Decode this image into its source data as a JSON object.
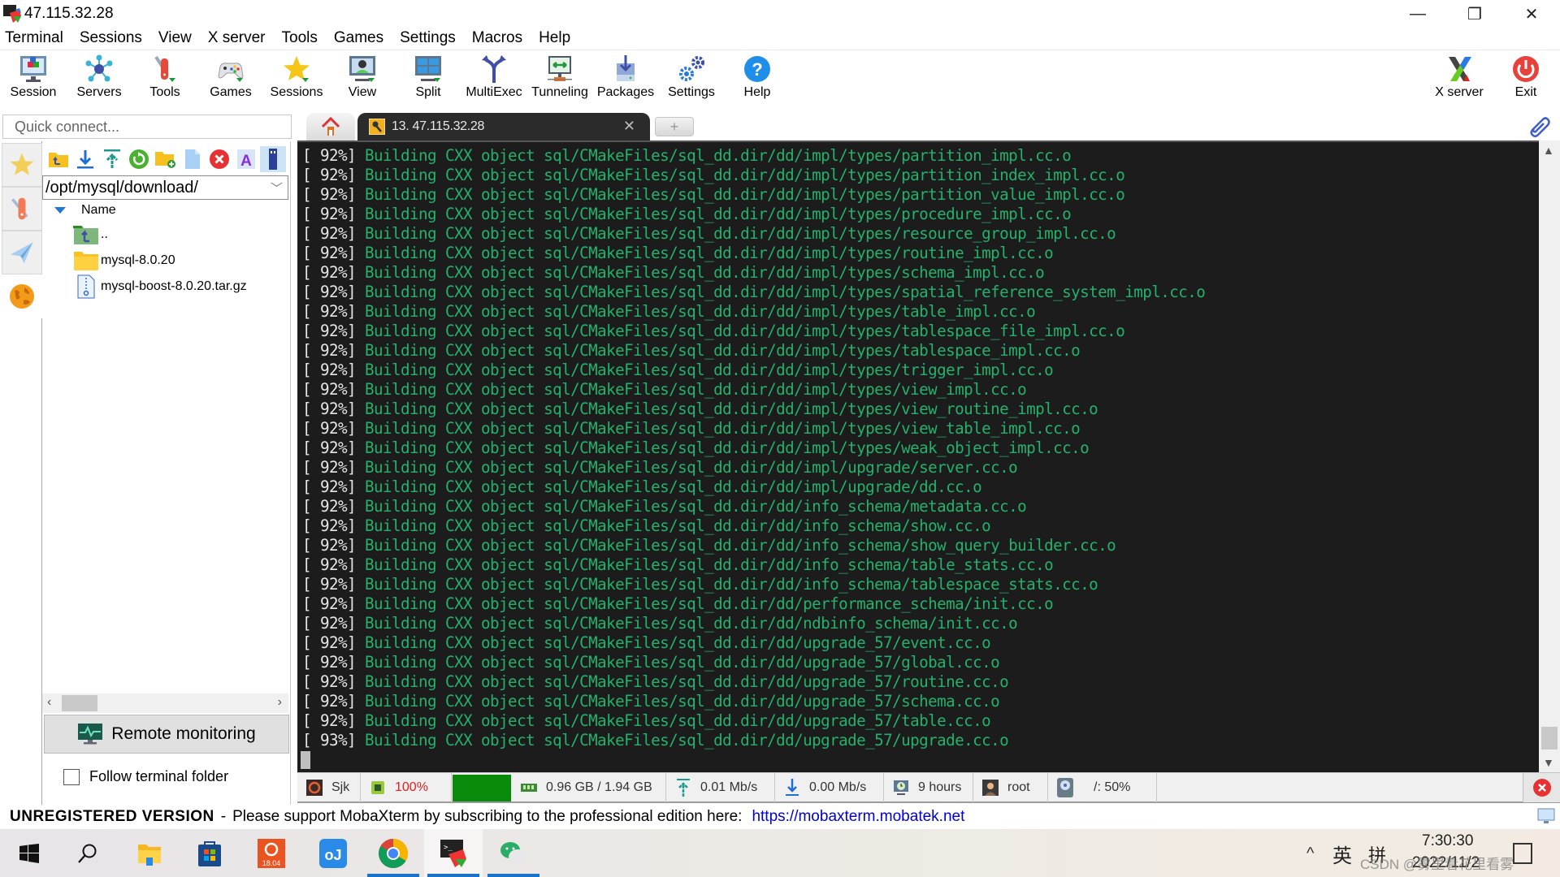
{
  "window": {
    "title": "47.115.32.28",
    "controls": {
      "minimize": "—",
      "maximize": "❐",
      "close": "✕"
    }
  },
  "menu": [
    "Terminal",
    "Sessions",
    "View",
    "X server",
    "Tools",
    "Games",
    "Settings",
    "Macros",
    "Help"
  ],
  "toolbar": {
    "buttons": [
      {
        "label": "Session",
        "icon": "session-icon"
      },
      {
        "label": "Servers",
        "icon": "servers-icon"
      },
      {
        "label": "Tools",
        "icon": "tools-icon"
      },
      {
        "label": "Games",
        "icon": "games-icon"
      },
      {
        "label": "Sessions",
        "icon": "sessions-star-icon"
      },
      {
        "label": "View",
        "icon": "view-icon"
      },
      {
        "label": "Split",
        "icon": "split-icon"
      },
      {
        "label": "MultiExec",
        "icon": "multiexec-icon"
      },
      {
        "label": "Tunneling",
        "icon": "tunneling-icon"
      },
      {
        "label": "Packages",
        "icon": "packages-icon"
      },
      {
        "label": "Settings",
        "icon": "settings-icon"
      },
      {
        "label": "Help",
        "icon": "help-icon"
      }
    ],
    "right_buttons": [
      {
        "label": "X server",
        "icon": "xserver-icon"
      },
      {
        "label": "Exit",
        "icon": "exit-icon"
      }
    ]
  },
  "quick_connect": {
    "placeholder": "Quick connect..."
  },
  "tabs": {
    "active_label": "13. 47.115.32.28",
    "close_glyph": "✕",
    "new_tab_glyph": "+"
  },
  "sftp": {
    "path": "/opt/mysql/download/",
    "column_header": "Name",
    "items": [
      {
        "name": "..",
        "type": "parent"
      },
      {
        "name": "mysql-8.0.20",
        "type": "folder"
      },
      {
        "name": "mysql-boost-8.0.20.tar.gz",
        "type": "archive"
      }
    ],
    "remote_monitoring_label": "Remote monitoring",
    "follow_terminal_label": "Follow terminal folder",
    "follow_terminal_checked": false
  },
  "terminal": {
    "lines": [
      {
        "pct": "[ 92%]",
        "msg": "Building CXX object sql/CMakeFiles/sql_dd.dir/dd/impl/types/partition_impl.cc.o"
      },
      {
        "pct": "[ 92%]",
        "msg": "Building CXX object sql/CMakeFiles/sql_dd.dir/dd/impl/types/partition_index_impl.cc.o"
      },
      {
        "pct": "[ 92%]",
        "msg": "Building CXX object sql/CMakeFiles/sql_dd.dir/dd/impl/types/partition_value_impl.cc.o"
      },
      {
        "pct": "[ 92%]",
        "msg": "Building CXX object sql/CMakeFiles/sql_dd.dir/dd/impl/types/procedure_impl.cc.o"
      },
      {
        "pct": "[ 92%]",
        "msg": "Building CXX object sql/CMakeFiles/sql_dd.dir/dd/impl/types/resource_group_impl.cc.o"
      },
      {
        "pct": "[ 92%]",
        "msg": "Building CXX object sql/CMakeFiles/sql_dd.dir/dd/impl/types/routine_impl.cc.o"
      },
      {
        "pct": "[ 92%]",
        "msg": "Building CXX object sql/CMakeFiles/sql_dd.dir/dd/impl/types/schema_impl.cc.o"
      },
      {
        "pct": "[ 92%]",
        "msg": "Building CXX object sql/CMakeFiles/sql_dd.dir/dd/impl/types/spatial_reference_system_impl.cc.o"
      },
      {
        "pct": "[ 92%]",
        "msg": "Building CXX object sql/CMakeFiles/sql_dd.dir/dd/impl/types/table_impl.cc.o"
      },
      {
        "pct": "[ 92%]",
        "msg": "Building CXX object sql/CMakeFiles/sql_dd.dir/dd/impl/types/tablespace_file_impl.cc.o"
      },
      {
        "pct": "[ 92%]",
        "msg": "Building CXX object sql/CMakeFiles/sql_dd.dir/dd/impl/types/tablespace_impl.cc.o"
      },
      {
        "pct": "[ 92%]",
        "msg": "Building CXX object sql/CMakeFiles/sql_dd.dir/dd/impl/types/trigger_impl.cc.o"
      },
      {
        "pct": "[ 92%]",
        "msg": "Building CXX object sql/CMakeFiles/sql_dd.dir/dd/impl/types/view_impl.cc.o"
      },
      {
        "pct": "[ 92%]",
        "msg": "Building CXX object sql/CMakeFiles/sql_dd.dir/dd/impl/types/view_routine_impl.cc.o"
      },
      {
        "pct": "[ 92%]",
        "msg": "Building CXX object sql/CMakeFiles/sql_dd.dir/dd/impl/types/view_table_impl.cc.o"
      },
      {
        "pct": "[ 92%]",
        "msg": "Building CXX object sql/CMakeFiles/sql_dd.dir/dd/impl/types/weak_object_impl.cc.o"
      },
      {
        "pct": "[ 92%]",
        "msg": "Building CXX object sql/CMakeFiles/sql_dd.dir/dd/impl/upgrade/server.cc.o"
      },
      {
        "pct": "[ 92%]",
        "msg": "Building CXX object sql/CMakeFiles/sql_dd.dir/dd/impl/upgrade/dd.cc.o"
      },
      {
        "pct": "[ 92%]",
        "msg": "Building CXX object sql/CMakeFiles/sql_dd.dir/dd/info_schema/metadata.cc.o"
      },
      {
        "pct": "[ 92%]",
        "msg": "Building CXX object sql/CMakeFiles/sql_dd.dir/dd/info_schema/show.cc.o"
      },
      {
        "pct": "[ 92%]",
        "msg": "Building CXX object sql/CMakeFiles/sql_dd.dir/dd/info_schema/show_query_builder.cc.o"
      },
      {
        "pct": "[ 92%]",
        "msg": "Building CXX object sql/CMakeFiles/sql_dd.dir/dd/info_schema/table_stats.cc.o"
      },
      {
        "pct": "[ 92%]",
        "msg": "Building CXX object sql/CMakeFiles/sql_dd.dir/dd/info_schema/tablespace_stats.cc.o"
      },
      {
        "pct": "[ 92%]",
        "msg": "Building CXX object sql/CMakeFiles/sql_dd.dir/dd/performance_schema/init.cc.o"
      },
      {
        "pct": "[ 92%]",
        "msg": "Building CXX object sql/CMakeFiles/sql_dd.dir/dd/ndbinfo_schema/init.cc.o"
      },
      {
        "pct": "[ 92%]",
        "msg": "Building CXX object sql/CMakeFiles/sql_dd.dir/dd/upgrade_57/event.cc.o"
      },
      {
        "pct": "[ 92%]",
        "msg": "Building CXX object sql/CMakeFiles/sql_dd.dir/dd/upgrade_57/global.cc.o"
      },
      {
        "pct": "[ 92%]",
        "msg": "Building CXX object sql/CMakeFiles/sql_dd.dir/dd/upgrade_57/routine.cc.o"
      },
      {
        "pct": "[ 92%]",
        "msg": "Building CXX object sql/CMakeFiles/sql_dd.dir/dd/upgrade_57/schema.cc.o"
      },
      {
        "pct": "[ 92%]",
        "msg": "Building CXX object sql/CMakeFiles/sql_dd.dir/dd/upgrade_57/table.cc.o"
      },
      {
        "pct": "[ 93%]",
        "msg": "Building CXX object sql/CMakeFiles/sql_dd.dir/dd/upgrade_57/upgrade.cc.o"
      }
    ],
    "text_color": "#23b16b",
    "bracket_color": "#e6e6e6",
    "background": "#1c1c1c"
  },
  "statusbar": {
    "host": "Sjk",
    "cpu": "100%",
    "memory": "0.96 GB / 1.94 GB",
    "upload": "0.01 Mb/s",
    "download": "0.00 Mb/s",
    "uptime": "9 hours",
    "user": "root",
    "disk": "/: 50%"
  },
  "banner": {
    "title": "UNREGISTERED VERSION",
    "separator": "-",
    "message": "Please support MobaXterm by subscribing to the professional edition here:",
    "link": "https://mobaxterm.mobatek.net"
  },
  "taskbar": {
    "apps": [
      "start",
      "search",
      "file-explorer",
      "store",
      "ubuntu-18.04",
      "mail",
      "chrome",
      "mobaxterm",
      "wechat"
    ],
    "ubuntu_label": "18.04",
    "tray_chevron": "^",
    "lang": "英",
    "ime": "拼",
    "time": "7:30:30",
    "date": "2022/11/2",
    "watermark": "CSDN @雾里看花里看雾"
  }
}
